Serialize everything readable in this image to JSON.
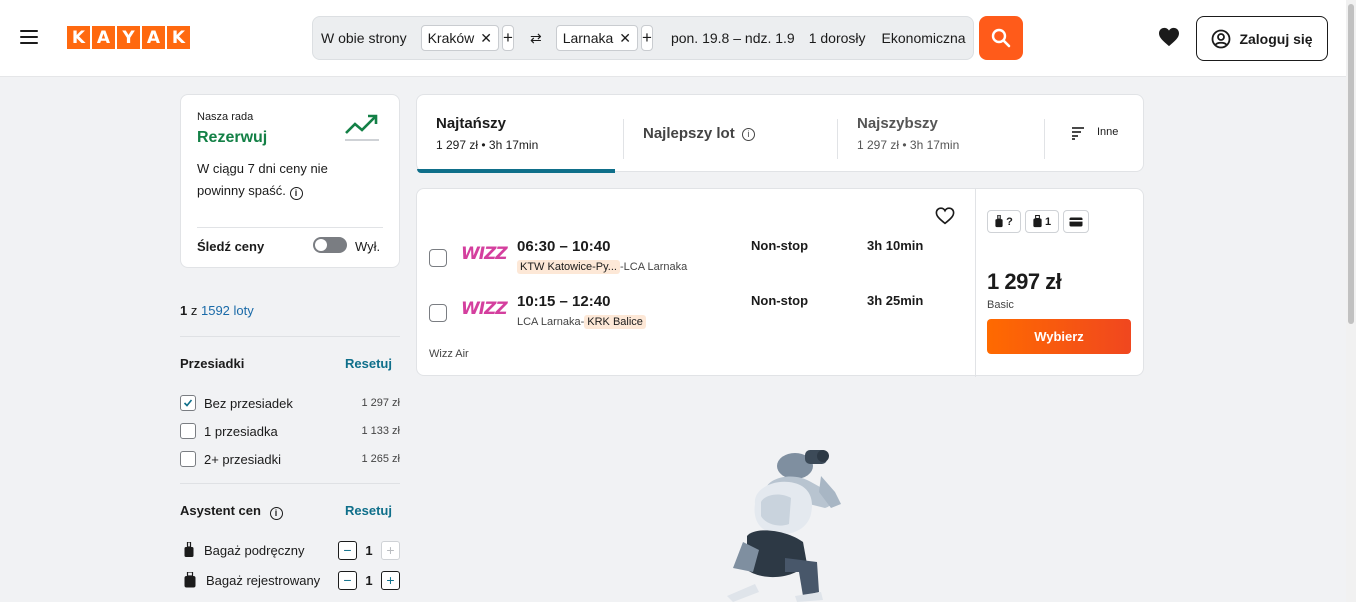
{
  "header": {
    "logo_letters": [
      "K",
      "A",
      "Y",
      "A",
      "K"
    ],
    "trip_type": "W obie strony",
    "origin": "Kraków",
    "destination": "Larnaka",
    "dates": "pon. 19.8 – ndz. 1.9",
    "travelers": "1 dorosły",
    "cabin": "Ekonomiczna",
    "login_label": "Zaloguj się"
  },
  "advice": {
    "kicker": "Nasza rada",
    "verdict": "Rezerwuj",
    "description": "W ciągu 7 dni ceny nie powinny spaść.",
    "track_label": "Śledź ceny",
    "toggle_state": "Wył."
  },
  "results_count": {
    "shown": "1",
    "of": "z",
    "total": "1592 loty"
  },
  "filters": {
    "stops": {
      "title": "Przesiadki",
      "reset": "Resetuj",
      "options": [
        {
          "label": "Bez przesiadek",
          "price": "1 297 zł",
          "checked": true
        },
        {
          "label": "1 przesiadka",
          "price": "1 133 zł",
          "checked": false
        },
        {
          "label": "2+ przesiadki",
          "price": "1 265 zł",
          "checked": false
        }
      ]
    },
    "assistant": {
      "title": "Asystent cen",
      "reset": "Resetuj",
      "bags": [
        {
          "label": "Bagaż podręczny",
          "value": "1"
        },
        {
          "label": "Bagaż rejestrowany",
          "value": "1"
        }
      ]
    }
  },
  "sort": {
    "cheapest": {
      "title": "Najtańszy",
      "sub": "1 297 zł • 3h 17min"
    },
    "best": {
      "title": "Najlepszy lot"
    },
    "fastest": {
      "title": "Najszybszy",
      "sub": "1 297 zł • 3h 17min"
    },
    "other": "Inne"
  },
  "result": {
    "airline_logo_text": "WIZZ",
    "legs": [
      {
        "times": "06:30 – 10:40",
        "from": "KTW Katowice-Py...",
        "to": "LCA Larnaka",
        "stops": "Non-stop",
        "duration": "3h 10min"
      },
      {
        "times": "10:15 – 12:40",
        "from": "LCA Larnaka",
        "to": "KRK Balice",
        "stops": "Non-stop",
        "duration": "3h 25min"
      }
    ],
    "operated_by": "Wizz Air",
    "bag_carry": "?",
    "bag_checked": "1",
    "price": "1 297 zł",
    "fare_class": "Basic",
    "select_label": "Wybierz"
  },
  "colors": {
    "brand": "#ff690f",
    "accent": "#0f6f8a",
    "positive": "#138046"
  }
}
